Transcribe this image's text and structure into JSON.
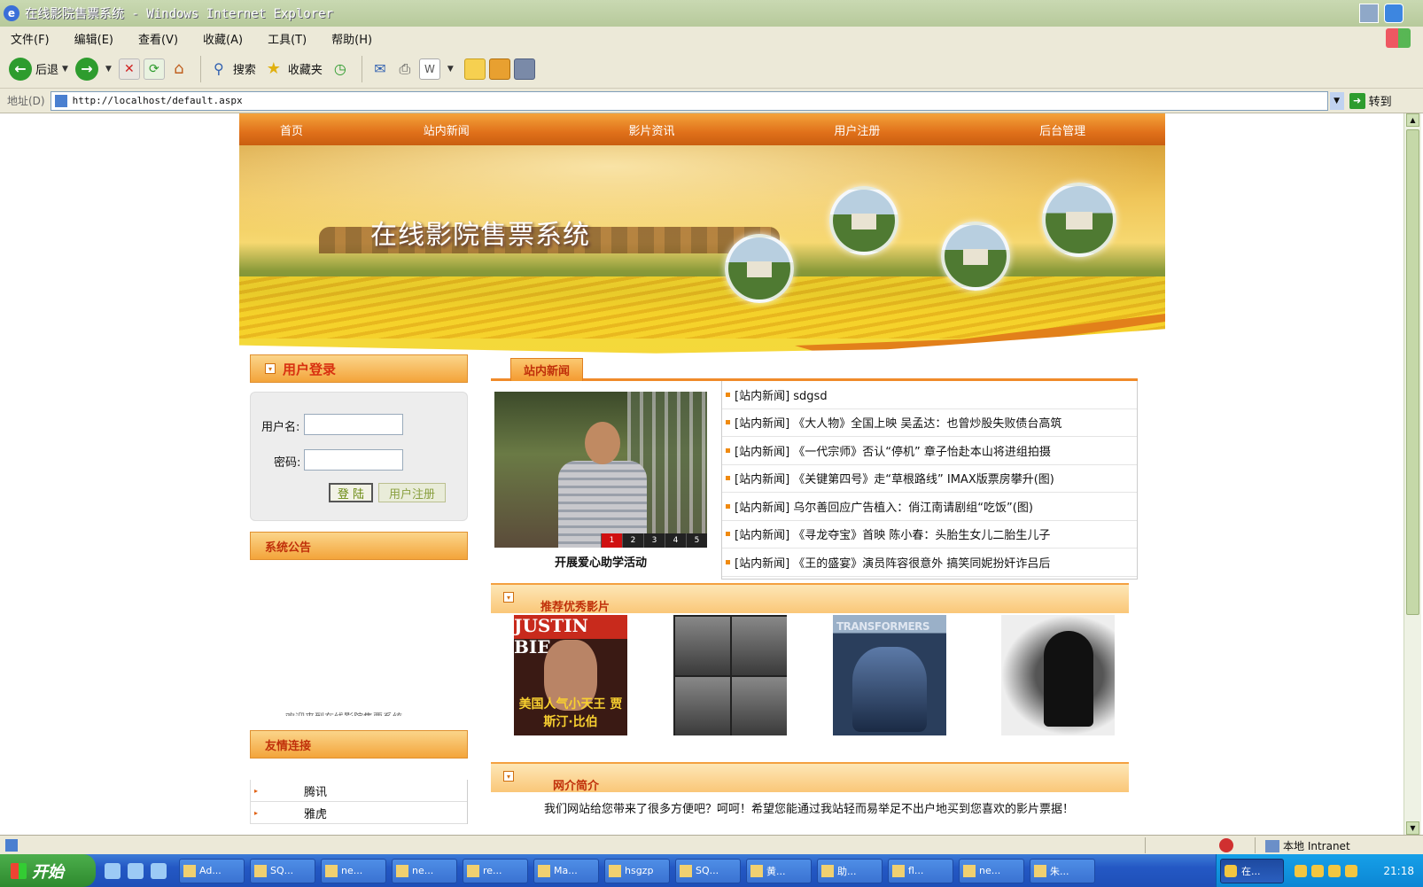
{
  "window": {
    "title": "在线影院售票系统 - Windows Internet Explorer"
  },
  "menu": [
    "文件(F)",
    "编辑(E)",
    "查看(V)",
    "收藏(A)",
    "工具(T)",
    "帮助(H)"
  ],
  "toolbar": {
    "back": "后退",
    "search": "搜索",
    "favorites": "收藏夹"
  },
  "address": {
    "label": "地址(D)",
    "url": "http://localhost/default.aspx",
    "go": "转到"
  },
  "site": {
    "nav": [
      "首页",
      "站内新闻",
      "影片资讯",
      "用户注册",
      "后台管理"
    ],
    "banner_title": "在线影院售票系统",
    "login": {
      "title": "用户登录",
      "username_label": "用户名:",
      "password_label": "密码:",
      "login_button": "登 陆",
      "register_button": "用户注册"
    },
    "notice": {
      "title": "系统公告",
      "scroll_text": "欢迎来到在线影院售票系统"
    },
    "links": {
      "title": "友情连接",
      "items": [
        "腾讯",
        "雅虎"
      ]
    },
    "news": {
      "tab": "站内新闻",
      "slide_caption": "开展爱心助学活动",
      "slide_pages": [
        "1",
        "2",
        "3",
        "4",
        "5"
      ],
      "items": [
        "[站内新闻] sdgsd",
        "[站内新闻] 《大人物》全国上映 吴孟达：也曾炒股失败债台高筑",
        "[站内新闻] 《一代宗师》否认“停机” 章子怡赴本山将进组拍摄",
        "[站内新闻] 《关键第四号》走“草根路线” IMAX版票房攀升(图)",
        "[站内新闻] 乌尔善回应广告植入：俏江南请剧组“吃饭”(图)",
        "[站内新闻] 《寻龙夺宝》首映 陈小春：头胎生女儿二胎生儿子",
        "[站内新闻] 《王的盛宴》演员阵容很意外 搞笑同妮扮奸诈吕后"
      ]
    },
    "recommend": {
      "title": "推荐优秀影片",
      "poster1_top": "JUSTIN BIE",
      "poster1_caption": "美国人气小天王 贾斯汀·比伯",
      "poster3_text": "TRANSFORMERS"
    },
    "intro": {
      "title": "网介简介",
      "text": "我们网站给您带来了很多方便吧？呵呵！希望您能通过我站轻而易举足不出户地买到您喜欢的影片票据！"
    }
  },
  "status": {
    "zone": "本地 Intranet"
  },
  "taskbar": {
    "start": "开始",
    "tasks": [
      "Ad...",
      "SQ...",
      "ne...",
      "ne...",
      "re...",
      "Ma...",
      "hsgzp",
      "SQ...",
      "黄...",
      "助...",
      "fl...",
      "ne...",
      "朱...",
      "在..."
    ],
    "clock": "21:18"
  }
}
